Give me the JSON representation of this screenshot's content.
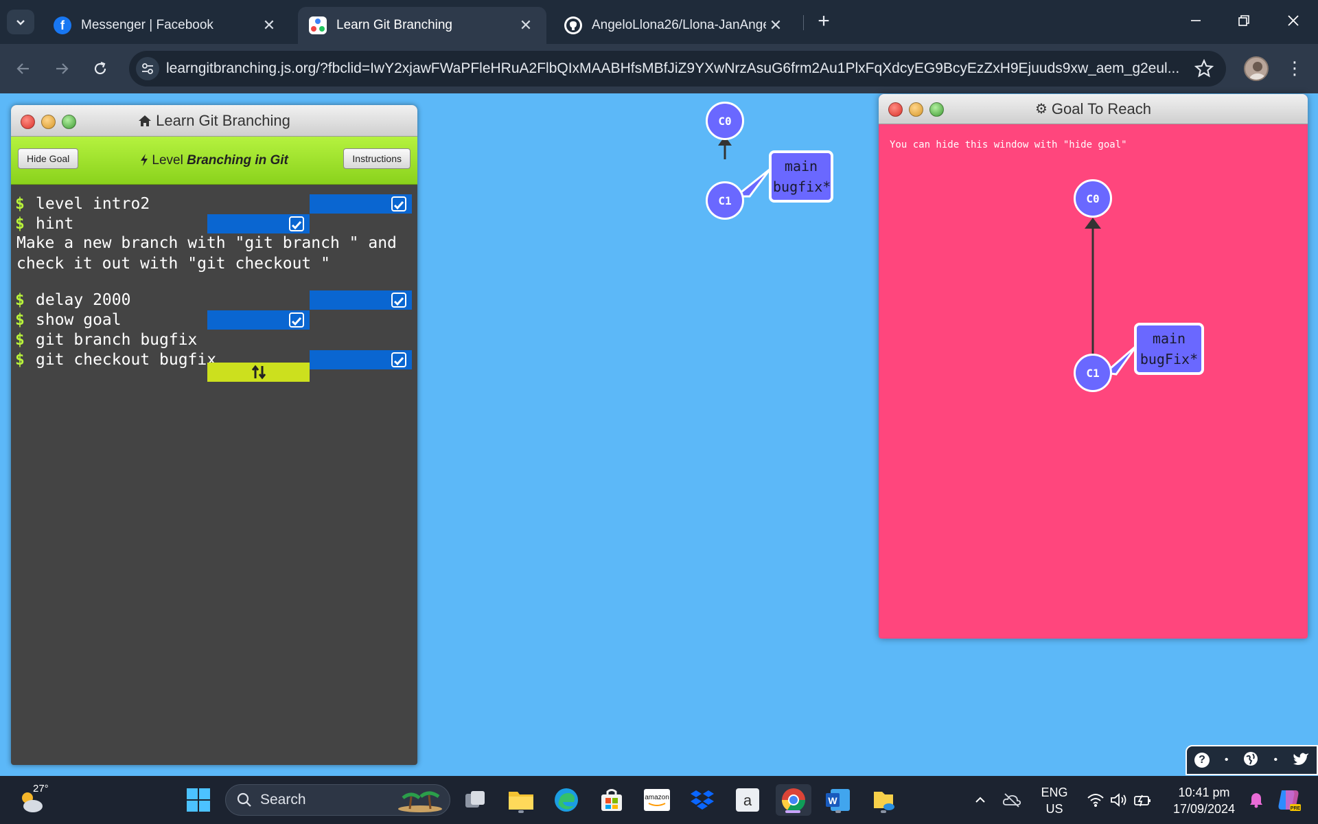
{
  "browser": {
    "tabs": [
      {
        "label": "Messenger | Facebook",
        "active": false
      },
      {
        "label": "Learn Git Branching",
        "active": true
      },
      {
        "label": "AngeloLlona26/Llona-JanAngelo",
        "active": false
      }
    ],
    "url": "learngitbranching.js.org/?fbclid=IwY2xjawFWaPFleHRuA2FlbQIxMAABHfsMBfJiZ9YXwNrzAsuG6frm2Au1PlxFqXdcyEG9BcyEzZxH9Ejuuds9xw_aem_g2eul..."
  },
  "terminal": {
    "title": "Learn Git Branching",
    "hide_goal_label": "Hide Goal",
    "level_prefix": "Level",
    "level_name": "Branching in Git",
    "instructions_label": "Instructions",
    "commands": [
      {
        "text": "level intro2",
        "status": "done"
      },
      {
        "text": "hint",
        "status": "done"
      },
      {
        "text": "delay 2000",
        "status": "done"
      },
      {
        "text": "show goal",
        "status": "done"
      },
      {
        "text": "git branch bugfix",
        "status": "none"
      },
      {
        "text": "git checkout bugfix",
        "status": "done"
      }
    ],
    "hint_text": "Make a new branch with \"git branch \" and\ncheck it out with \"git checkout \"",
    "prompt_symbol": "$"
  },
  "main_graph": {
    "commits": [
      "C0",
      "C1"
    ],
    "branch_label_lines": [
      "main",
      "bugfix*"
    ]
  },
  "goal": {
    "title": "Goal To Reach",
    "note": "You can hide this window with \"hide goal\"",
    "commits": [
      "C0",
      "C1"
    ],
    "branch_label_lines": [
      "main",
      "bugFix*"
    ]
  },
  "taskbar": {
    "weather_temp": "27°",
    "search_placeholder": "Search",
    "lang_line1": "ENG",
    "lang_line2": "US",
    "time": "10:41 pm",
    "date": "17/09/2024"
  },
  "colors": {
    "desktop_bg": "#5cb8f8",
    "terminal_bg": "#444444",
    "level_bar": "#9ee02a",
    "goal_bg": "#ff467d",
    "commit_fill": "#6a68ff",
    "status_done": "#0a66d1",
    "status_pending": "#cce01e"
  }
}
